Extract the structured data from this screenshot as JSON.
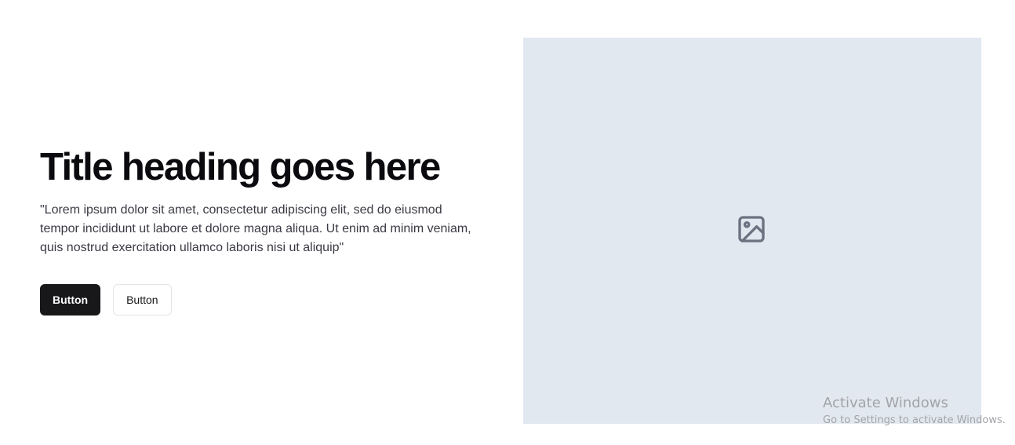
{
  "hero": {
    "title": "Title heading goes here",
    "body": "\"Lorem ipsum dolor sit amet, consectetur adipiscing elit, sed do eiusmod tempor incididunt ut labore et dolore magna aliqua. Ut enim ad minim veniam, quis nostrud exercitation ullamco laboris nisi ut aliquip\"",
    "primary_button_label": "Button",
    "secondary_button_label": "Button"
  },
  "media": {
    "icon": "image-icon",
    "background_color": "#e2e8f0",
    "icon_color": "#6b7280"
  },
  "watermark": {
    "title": "Activate Windows",
    "subtitle": "Go to Settings to activate Windows."
  },
  "colors": {
    "primary_button": "#18181b",
    "heading": "#0b0b0f",
    "body_text": "#3a3a44"
  }
}
